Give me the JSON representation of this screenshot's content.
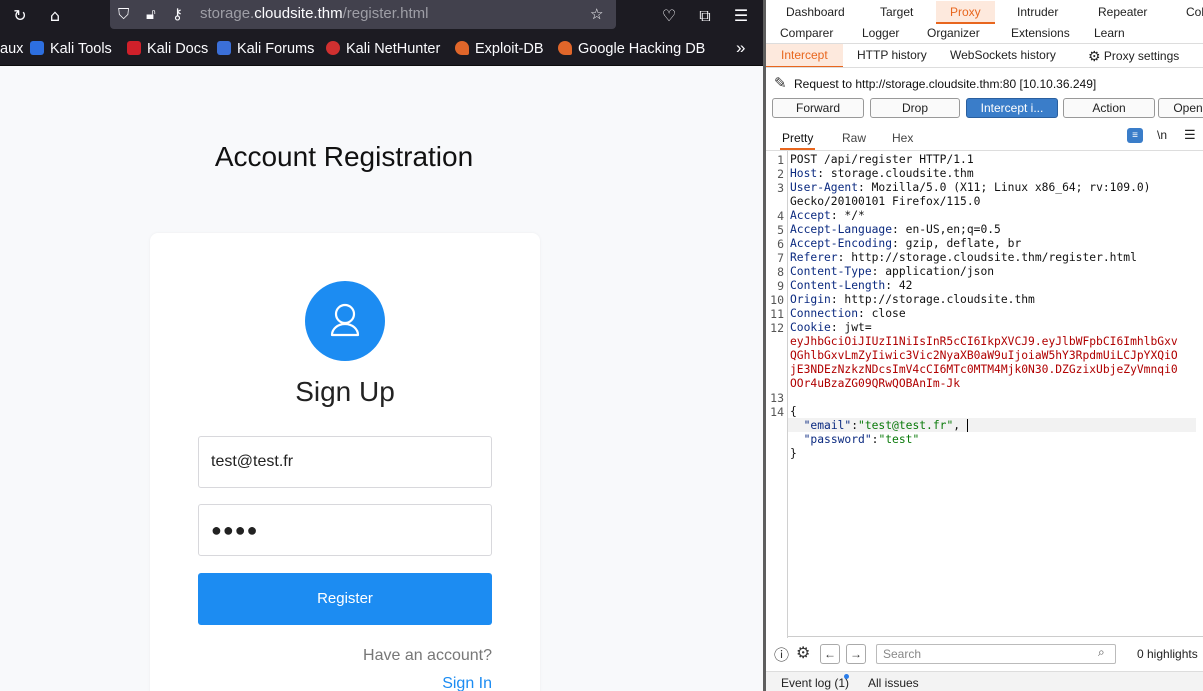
{
  "browser": {
    "url_prefix": "storage.",
    "url_domain": "cloudsite.thm",
    "url_path": "/register.html",
    "bookmarks": [
      "aux",
      "Kali Tools",
      "Kali Docs",
      "Kali Forums",
      "Kali NetHunter",
      "Exploit-DB",
      "Google Hacking DB"
    ],
    "overflow": "»"
  },
  "page": {
    "title": "Account Registration",
    "heading": "Sign Up",
    "email_value": "test@test.fr",
    "password_value": "●●●●",
    "register_label": "Register",
    "have_account": "Have an account?",
    "sign_in": "Sign In"
  },
  "burp": {
    "main_tabs": [
      "Dashboard",
      "Target",
      "Proxy",
      "Intruder",
      "Repeater",
      "Col"
    ],
    "main_tabs_row2": [
      "Comparer",
      "Logger",
      "Organizer",
      "Extensions",
      "Learn"
    ],
    "sub_tabs": [
      "Intercept",
      "HTTP history",
      "WebSockets history",
      "Proxy settings"
    ],
    "request_line": "Request to http://storage.cloudsite.thm:80  [10.10.36.249]",
    "actions": [
      "Forward",
      "Drop",
      "Intercept i...",
      "Action",
      "Open"
    ],
    "view_tabs": [
      "Pretty",
      "Raw",
      "Hex"
    ],
    "newline_toggle": "\\n",
    "search_placeholder": "Search",
    "highlights": "0 highlights",
    "event_log": "Event log (1)",
    "all_issues": "All issues",
    "accent": "#e8661e",
    "request": {
      "l1": "POST /api/register HTTP/1.1",
      "h2k": "Host",
      "h2v": " storage.cloudsite.thm",
      "h3k": "User-Agent",
      "h3v": " Mozilla/5.0 (X11; Linux x86_64; rv:109.0)",
      "h3v2": "Gecko/20100101 Firefox/115.0",
      "h4k": "Accept",
      "h4v": " */*",
      "h5k": "Accept-Language",
      "h5v": " en-US,en;q=0.5",
      "h6k": "Accept-Encoding",
      "h6v": " gzip, deflate, br",
      "h7k": "Referer",
      "h7v": " http://storage.cloudsite.thm/register.html",
      "h8k": "Content-Type",
      "h8v": " application/json",
      "h9k": "Content-Length",
      "h9v": " 42",
      "h10k": "Origin",
      "h10v": " http://storage.cloudsite.thm",
      "h11k": "Connection",
      "h11v": " close",
      "h12k": "Cookie",
      "h12v": " jwt=",
      "jwt1": "eyJhbGciOiJIUzI1NiIsInR5cCI6IkpXVCJ9.eyJlbWFpbCI6ImhlbGxv",
      "jwt2": "QGhlbGxvLmZyIiwic3Vic2NyaXB0aW9uIjoiaW5hY3RpdmUiLCJpYXQiO",
      "jwt3": "jE3NDEzNzkzNDcsImV4cCI6MTc0MTM4Mjk0N30.DZGzixUbjeZyVmnqi0",
      "jwt4": "OOr4uBzaZG09QRwQOBAnIm-Jk",
      "b_open": "{",
      "b_email_k": "\"email\"",
      "b_email_v": "\"test@test.fr\"",
      "b_pw_k": "\"password\"",
      "b_pw_v": "\"test\"",
      "b_close": "}"
    },
    "line_numbers": [
      "1",
      "2",
      "3",
      "4",
      "5",
      "6",
      "7",
      "8",
      "9",
      "10",
      "11",
      "12",
      "13",
      "14"
    ]
  }
}
